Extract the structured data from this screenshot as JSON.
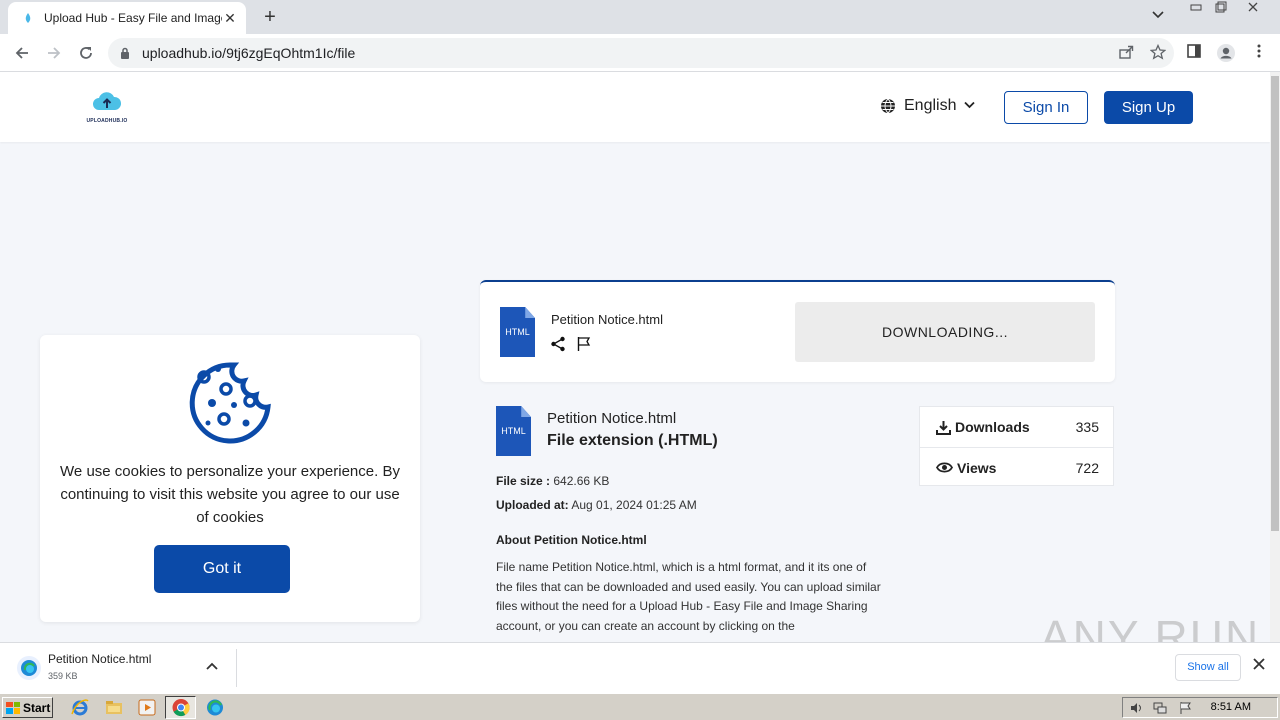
{
  "browser": {
    "tab_title": "Upload Hub - Easy File and Image Sh",
    "new_tab": "+",
    "url": "uploadhub.io/9tj6zgEqOhtm1Ic/file"
  },
  "header": {
    "logo_text": "UPLOADHUB.IO",
    "language": "English",
    "sign_in": "Sign In",
    "sign_up": "Sign Up"
  },
  "download_card": {
    "file_name": "Petition Notice.html",
    "file_type_label": "HTML",
    "button": "DOWNLOADING..."
  },
  "file_info": {
    "name": "Petition Notice.html",
    "extension": "File extension (.HTML)",
    "size_label": "File size :",
    "size_value": "642.66 KB",
    "uploaded_label": "Uploaded at:",
    "uploaded_value": "Aug 01, 2024 01:25 AM",
    "about_heading": "About Petition Notice.html",
    "about_text": "File name Petition Notice.html, which is a html format, and it its one of the files that can be downloaded and used easily. You can upload similar files without the need for a Upload Hub - Easy File and Image Sharing account, or you can create an account by clicking on the"
  },
  "stats": {
    "downloads_label": "Downloads",
    "downloads_value": "335",
    "views_label": "Views",
    "views_value": "722"
  },
  "cookie": {
    "message": "We use cookies to personalize your experience. By continuing to visit this website you agree to our use of cookies",
    "button": "Got it"
  },
  "watermark": "ANY RUN",
  "download_shelf": {
    "file_name": "Petition Notice.html",
    "file_size": "359 KB",
    "show_all": "Show all"
  },
  "taskbar": {
    "start": "Start",
    "clock": "8:51 AM"
  },
  "colors": {
    "brand_blue": "#0b4aa8",
    "file_icon_blue": "#1d56b8",
    "page_bg": "#f4f6fa"
  }
}
